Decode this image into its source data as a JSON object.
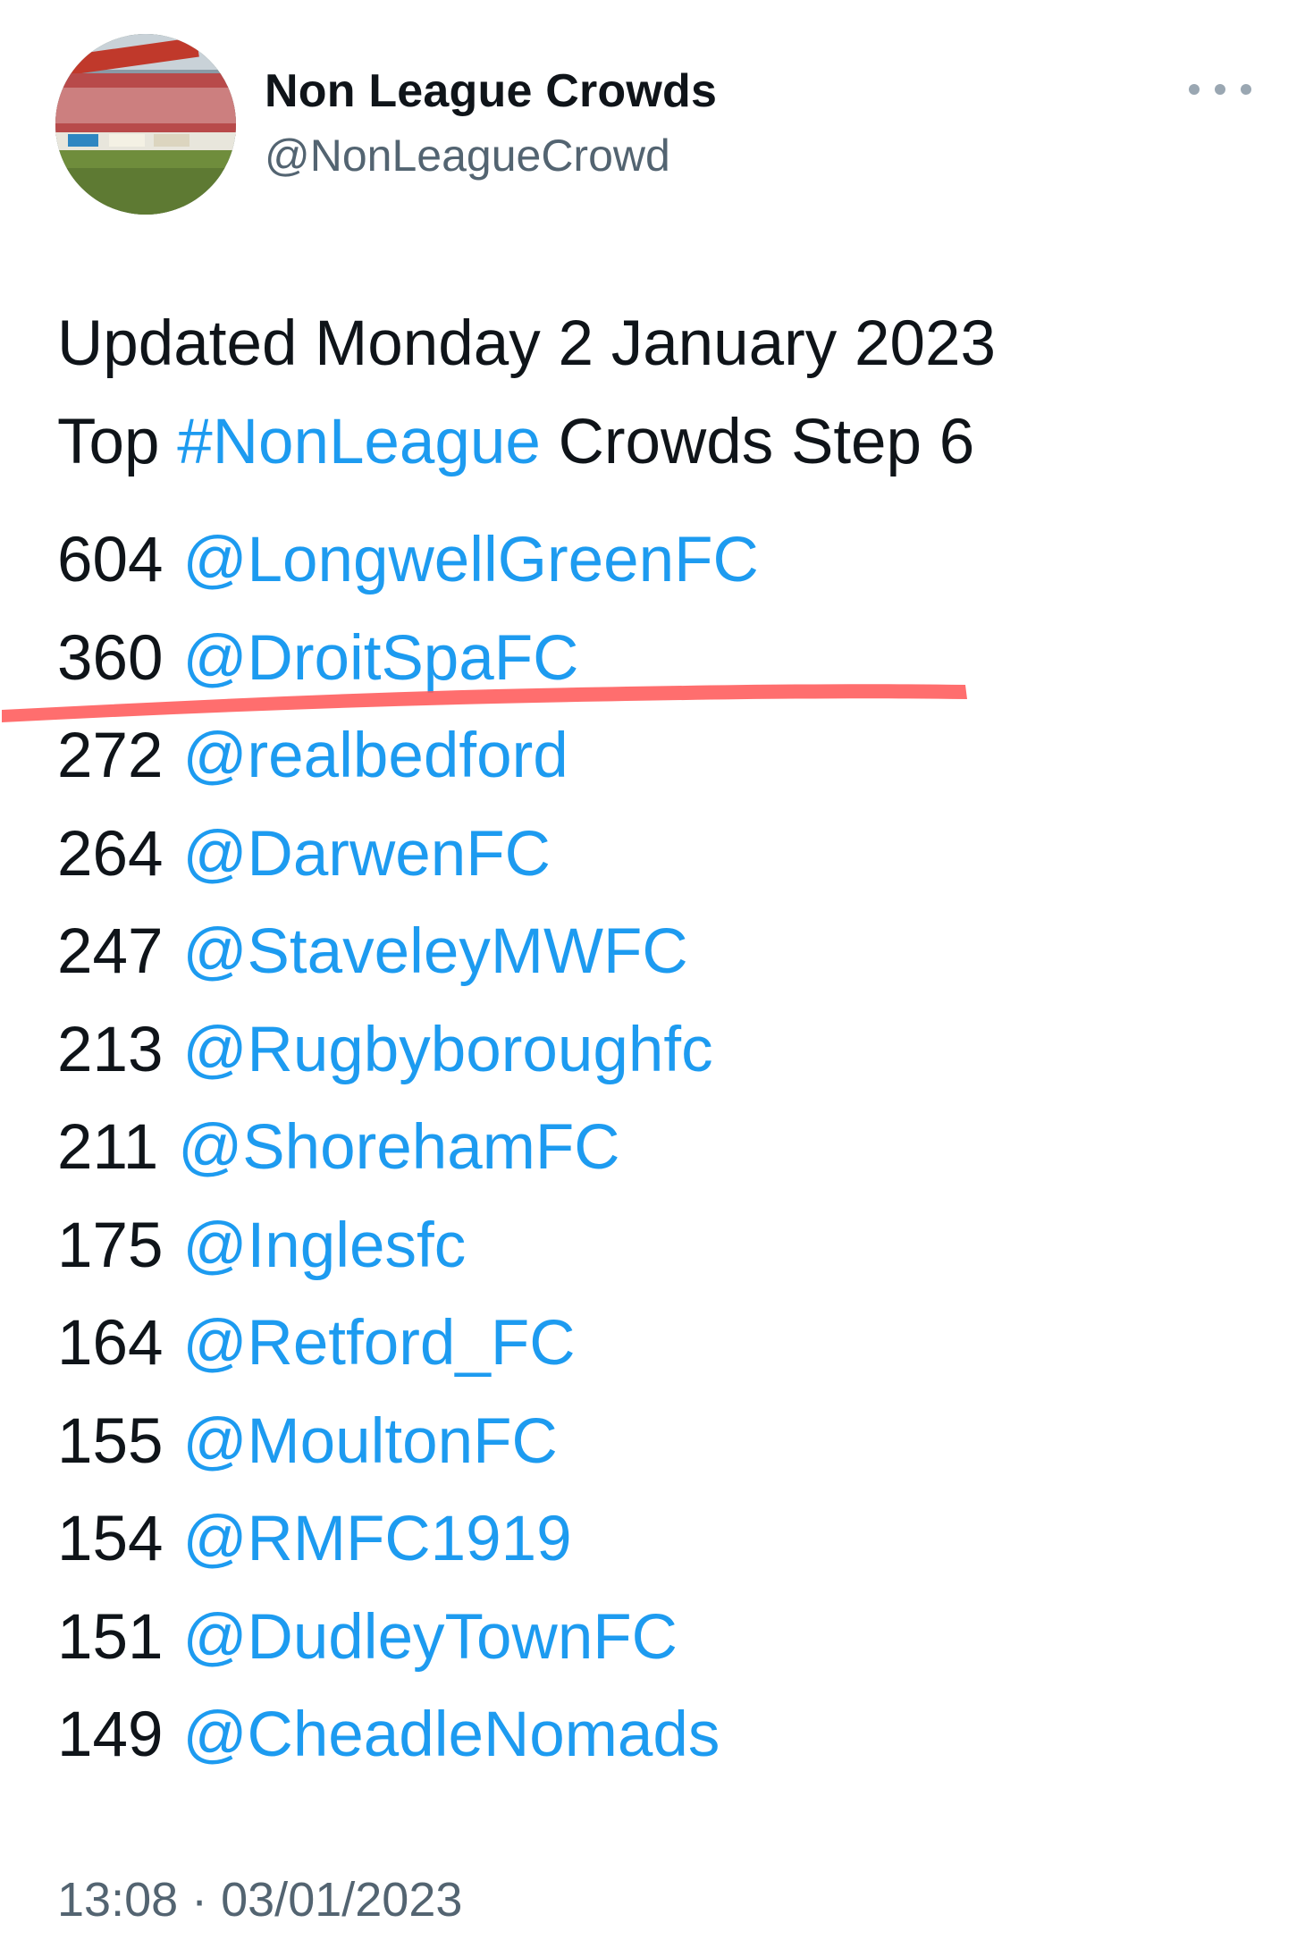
{
  "author": {
    "name": "Non League Crowds",
    "handle": "@NonLeagueCrowd"
  },
  "tweet": {
    "line1": "Updated Monday 2 January 2023",
    "line2_prefix": "Top ",
    "line2_hashtag": "#NonLeague",
    "line2_suffix": " Crowds Step 6",
    "rows": [
      {
        "count": "604",
        "handle": "@LongwellGreenFC"
      },
      {
        "count": "360",
        "handle": "@DroitSpaFC"
      },
      {
        "count": "272",
        "handle": "@realbedford"
      },
      {
        "count": "264",
        "handle": "@DarwenFC"
      },
      {
        "count": "247",
        "handle": "@StaveleyMWFC"
      },
      {
        "count": "213",
        "handle": "@Rugbyboroughfc"
      },
      {
        "count": "211",
        "handle": "@ShorehamFC"
      },
      {
        "count": "175",
        "handle": "@Inglesfc"
      },
      {
        "count": "164",
        "handle": "@Retford_FC"
      },
      {
        "count": "155",
        "handle": "@MoultonFC"
      },
      {
        "count": "154",
        "handle": "@RMFC1919"
      },
      {
        "count": "151",
        "handle": "@DudleyTownFC"
      },
      {
        "count": "149",
        "handle": "@CheadleNomads"
      }
    ],
    "timestamp": "13:08 · 03/01/2023"
  },
  "icons": {
    "more": "more-horizontal-icon"
  },
  "colors": {
    "link": "#1d9bf0",
    "text": "#0f1419",
    "secondary": "#536471",
    "annotation": "#ff5a5a"
  }
}
